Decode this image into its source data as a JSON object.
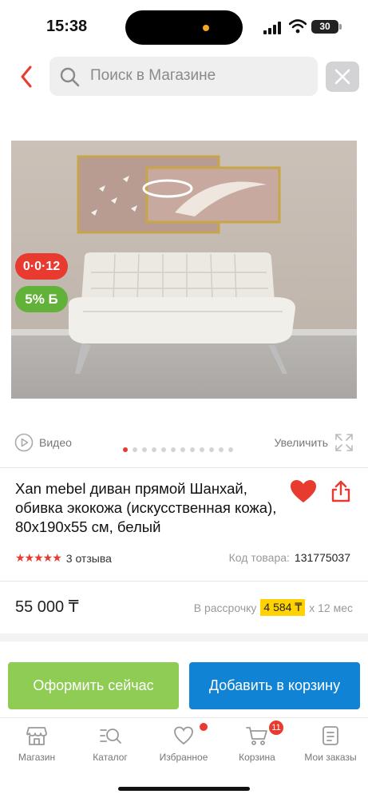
{
  "status_bar": {
    "time": "15:38",
    "battery": "30"
  },
  "search": {
    "placeholder": "Поиск в Магазине"
  },
  "promos": {
    "timer_badge": "0·0·12",
    "discount_badge": "5% Б"
  },
  "media": {
    "video_label": "Видео",
    "zoom_label": "Увеличить",
    "image_count": 12,
    "active_image": 1
  },
  "product": {
    "title": "Xan mebel диван прямой Шанхай, обивка экокожа (искусственная кожа), 80x190x55 см, белый",
    "rating_stars": "★★★★★",
    "rating_value": 4.5,
    "reviews": "3 отзыва",
    "code_label": "Код товара:",
    "code_value": "131775037",
    "price": "55 000 ₸",
    "installment_label": "В рассрочку",
    "installment_amount": "4 584 ₸",
    "installment_term": "х 12 мес"
  },
  "actions": {
    "buy_now": "Оформить сейчас",
    "add_to_cart": "Добавить в корзину"
  },
  "tabbar": {
    "items": [
      {
        "label": "Магазин",
        "icon": "store-icon"
      },
      {
        "label": "Каталог",
        "icon": "catalog-search-icon"
      },
      {
        "label": "Избранное",
        "icon": "heart-icon"
      },
      {
        "label": "Корзина",
        "icon": "cart-icon"
      },
      {
        "label": "Мои заказы",
        "icon": "orders-icon"
      }
    ],
    "cart_badge": "11"
  },
  "colors": {
    "accent_red": "#e83a2f",
    "buy_green": "#8fcc54",
    "cart_blue": "#1083d4",
    "installment_yellow": "#ffd200"
  }
}
